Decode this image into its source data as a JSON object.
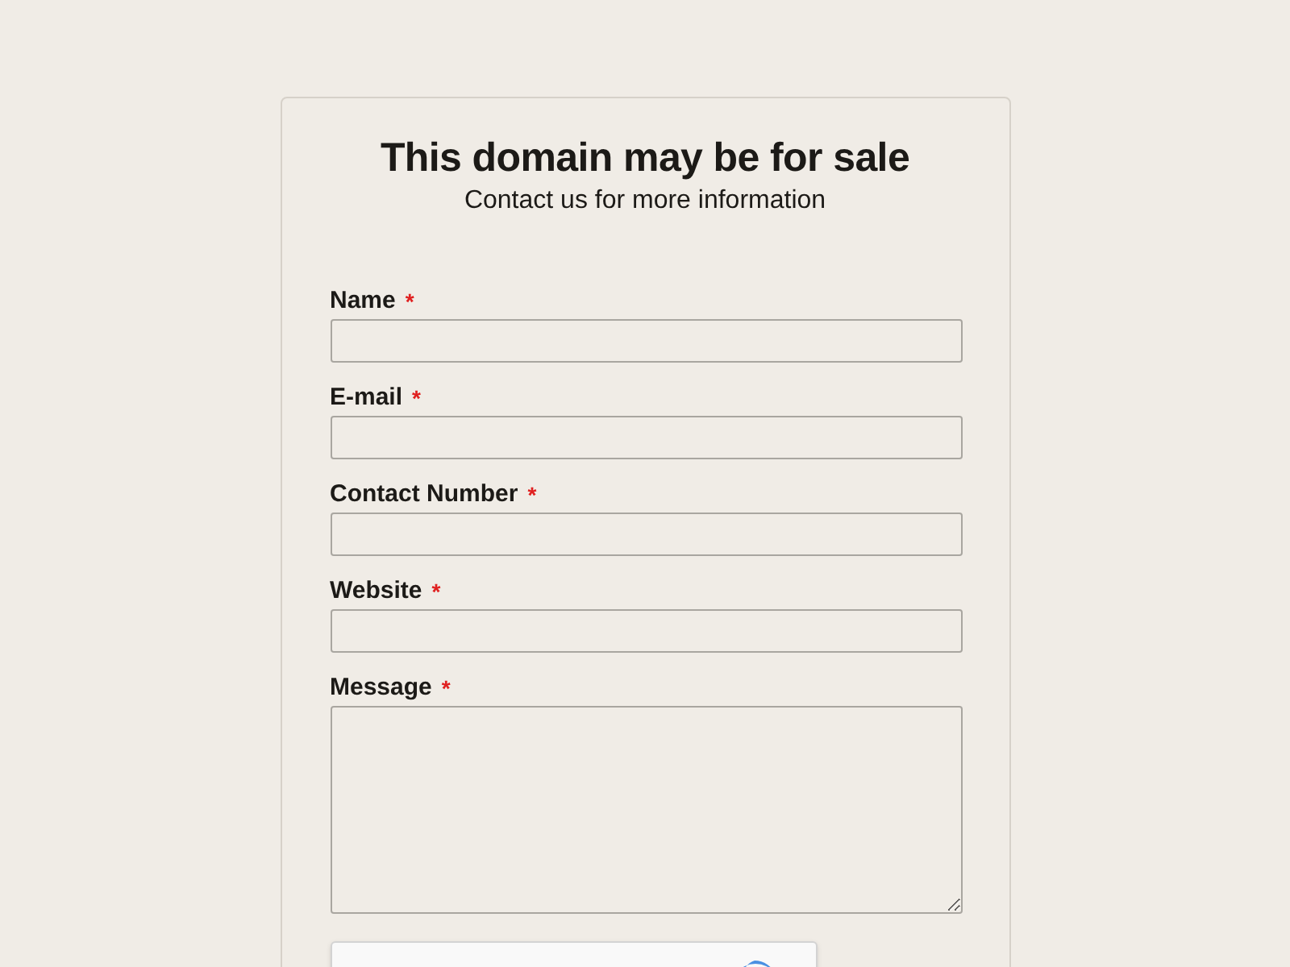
{
  "title": "This domain may be for sale",
  "subtitle": "Contact us for more information",
  "fields": [
    {
      "label": "Name",
      "mark": "*",
      "kind": "input"
    },
    {
      "label": "E-mail",
      "mark": "*",
      "kind": "input"
    },
    {
      "label": "Contact Number",
      "mark": "*",
      "kind": "input"
    },
    {
      "label": "Website",
      "mark": "*",
      "kind": "input"
    },
    {
      "label": "Message",
      "mark": "*",
      "kind": "textarea"
    }
  ]
}
